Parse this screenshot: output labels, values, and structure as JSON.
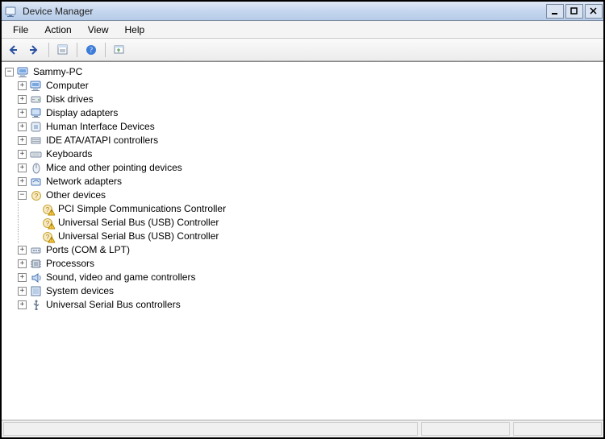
{
  "title": "Device Manager",
  "menu": {
    "file": "File",
    "action": "Action",
    "view": "View",
    "help": "Help"
  },
  "tree": {
    "root": {
      "label": "Sammy-PC",
      "expanded": true
    },
    "categories": [
      {
        "label": "Computer",
        "icon": "computer",
        "expanded": false
      },
      {
        "label": "Disk drives",
        "icon": "disk",
        "expanded": false
      },
      {
        "label": "Display adapters",
        "icon": "display",
        "expanded": false
      },
      {
        "label": "Human Interface Devices",
        "icon": "hid",
        "expanded": false
      },
      {
        "label": "IDE ATA/ATAPI controllers",
        "icon": "ide",
        "expanded": false
      },
      {
        "label": "Keyboards",
        "icon": "keyboard",
        "expanded": false
      },
      {
        "label": "Mice and other pointing devices",
        "icon": "mouse",
        "expanded": false
      },
      {
        "label": "Network adapters",
        "icon": "network",
        "expanded": false
      },
      {
        "label": "Other devices",
        "icon": "other",
        "expanded": true,
        "children": [
          {
            "label": "PCI Simple Communications Controller",
            "icon": "warning"
          },
          {
            "label": "Universal Serial Bus (USB) Controller",
            "icon": "warning"
          },
          {
            "label": "Universal Serial Bus (USB) Controller",
            "icon": "warning"
          }
        ]
      },
      {
        "label": "Ports (COM & LPT)",
        "icon": "port",
        "expanded": false
      },
      {
        "label": "Processors",
        "icon": "cpu",
        "expanded": false
      },
      {
        "label": "Sound, video and game controllers",
        "icon": "sound",
        "expanded": false
      },
      {
        "label": "System devices",
        "icon": "system",
        "expanded": false
      },
      {
        "label": "Universal Serial Bus controllers",
        "icon": "usb",
        "expanded": false
      }
    ]
  },
  "expanders": {
    "plus": "+",
    "minus": "−"
  }
}
